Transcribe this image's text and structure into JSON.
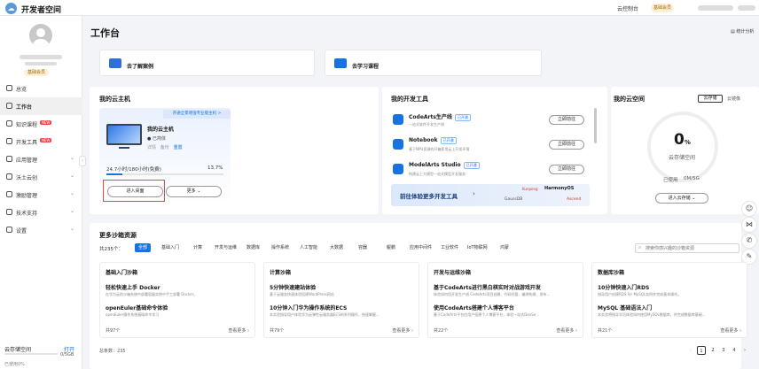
{
  "topbar": {
    "logo_icon": "cloud-icon",
    "title": "开发者空间",
    "console": "云控制台",
    "member": "基础会员"
  },
  "sidebar": {
    "badge": "基础会员",
    "items": [
      {
        "label": "总览",
        "icon": "home-icon"
      },
      {
        "label": "工作台",
        "icon": "desk-icon",
        "active": true
      },
      {
        "label": "知识课程",
        "icon": "book-icon",
        "new": "NEW"
      },
      {
        "label": "开发工具",
        "icon": "tool-icon",
        "new": "NEW"
      },
      {
        "label": "应用管理",
        "icon": "app-icon",
        "chevron": true
      },
      {
        "label": "沃土云创",
        "icon": "cloud-icon",
        "chevron": true
      },
      {
        "label": "激励管理",
        "icon": "gift-icon",
        "chevron": true
      },
      {
        "label": "技术支持",
        "icon": "support-icon",
        "chevron": true
      },
      {
        "label": "设置",
        "icon": "gear-icon",
        "chevron": true
      }
    ],
    "storage_label": "云存储空间",
    "storage_action": "打开",
    "storage_value": "0/5GB",
    "storage_used": "已使用0%"
  },
  "main": {
    "title": "工作台",
    "stats": "统计分析",
    "banners": [
      {
        "label": "去了解案例"
      },
      {
        "label": "去学习课程"
      }
    ]
  },
  "cloud_host": {
    "title": "我的云主机",
    "promo": "开通全景增强专业版主机 >",
    "name": "我的云主机",
    "status": "已简体",
    "links": [
      "详情",
      "备份",
      "重置"
    ],
    "time_text": "24.7小时/180小时(免费)",
    "percent": "13.7%",
    "progress": 0.137,
    "enter_btn": "进入桌面",
    "more_btn": "更多"
  },
  "dev_tools": {
    "title": "我的开发工具",
    "items": [
      {
        "name": "CodeArts生产线",
        "tag": "已开通",
        "desc": "一站式软件开发生产线",
        "btn": "立即前往"
      },
      {
        "name": "Notebook",
        "tag": "已开通",
        "desc": "基于NPU资源的开箱即用云上开发环境",
        "btn": "立即前往"
      },
      {
        "name": "ModelArts Studio",
        "tag": "已开通",
        "desc": "构建云上大模型一站式模型开发服务",
        "btn": "立即前往"
      }
    ],
    "promo": "前往体验更多开发工具",
    "partners": [
      "Kunpeng",
      "HarmonyOS",
      "GaussDB",
      "Ascend"
    ]
  },
  "cloud_space": {
    "title": "我的云空间",
    "tabs": [
      "云存储",
      "云镜像"
    ],
    "value": "0",
    "unit": "%",
    "label": "云存储空间",
    "used": "已使用",
    "capacity": "0M/5G",
    "btn": "进入云存储"
  },
  "sandbox": {
    "title": "更多沙箱资源",
    "count": "共235个：",
    "categories": [
      "全部",
      "基础入门",
      "计算",
      "开发与运维",
      "数据库",
      "操作系统",
      "人工智能",
      "大数据",
      "容器",
      "鲲鹏",
      "应用中间件",
      "工业软件",
      "IoT物联网",
      "鸿蒙"
    ],
    "search_placeholder": "搜索你感兴趣的沙箱资源",
    "cards": [
      {
        "header": "基础入门沙箱",
        "t1": "轻松快速上手 Docker",
        "d1": "在华为云的沙箱系统中部署容器实例中手工部署 Docker。",
        "t2": "openEuler基础命令体验",
        "d2": "openEuler操作系统基础命令学习",
        "count": "共97个",
        "more": "查看更多"
      },
      {
        "header": "计算沙箱",
        "t1": "5分钟快速建站体验",
        "d1": "基于云服务快速体验搭建WordPress网站",
        "t2": "10分钟入门华为操作系统的ECS",
        "d2": "本实验指导用户体验华为云弹性云服务器ECS的系列操作，快速掌握...",
        "count": "共79个",
        "more": "查看更多"
      },
      {
        "header": "开发与运维沙箱",
        "t1": "基于CodeArts进行黑白棋实时对战游戏开发",
        "d1": "体验如何用开发生产线 CodeArts项目创建、代码托管、编译构建、发布...",
        "t2": "使用CodeArts搭建个人博客平台",
        "d2": "基于CodeArts平台应用户搭建个人博客平台，体验一站式DevSe...",
        "count": "共22个",
        "more": "查看更多"
      },
      {
        "header": "数据库沙箱",
        "t1": "10分钟快速入门RDS",
        "d1": "指导用户创建RDS for MySQL实例并完成基本操作。",
        "t2": "MySQL 基础语法入门",
        "d2": "本实验将指导学员体验如何使用MySQL数据库，并完成数据库基础...",
        "count": "共21个",
        "more": "查看更多"
      }
    ],
    "total": "总条数：235",
    "pages": [
      "1",
      "2",
      "3",
      "4"
    ],
    "current_page": "1"
  },
  "float_icons": [
    "smile-icon",
    "share-icon",
    "phone-icon",
    "feedback-icon"
  ],
  "colors": {
    "accent": "#1673e0",
    "new_badge": "#e84444",
    "highlight": "#e84444"
  }
}
